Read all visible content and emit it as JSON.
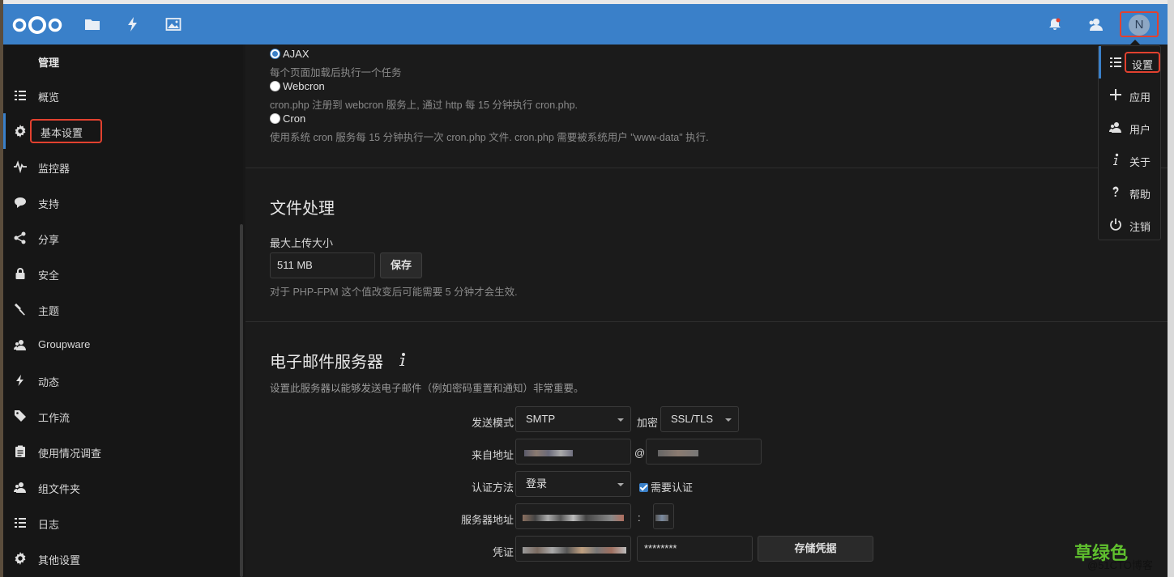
{
  "header": {
    "apps": [
      "files-icon",
      "activity-icon",
      "gallery-icon"
    ],
    "avatar_initial": "N"
  },
  "sidebar": {
    "heading": "管理",
    "items": [
      {
        "label": "概览",
        "icon": "list-icon"
      },
      {
        "label": "基本设置",
        "icon": "gear-icon",
        "active": true
      },
      {
        "label": "监控器",
        "icon": "pulse-icon"
      },
      {
        "label": "支持",
        "icon": "chat-bubble-icon"
      },
      {
        "label": "分享",
        "icon": "share-icon"
      },
      {
        "label": "安全",
        "icon": "lock-icon"
      },
      {
        "label": "主题",
        "icon": "brush-icon"
      },
      {
        "label": "Groupware",
        "icon": "users-icon"
      },
      {
        "label": "动态",
        "icon": "lightning-icon"
      },
      {
        "label": "工作流",
        "icon": "tag-icon"
      },
      {
        "label": "使用情况调查",
        "icon": "clipboard-icon"
      },
      {
        "label": "组文件夹",
        "icon": "group-icon"
      },
      {
        "label": "日志",
        "icon": "log-icon"
      },
      {
        "label": "其他设置",
        "icon": "gear-icon"
      }
    ]
  },
  "cron": {
    "ajax_label": "AJAX",
    "ajax_hint": "每个页面加载后执行一个任务",
    "webcron_label": "Webcron",
    "webcron_hint": "cron.php 注册到 webcron 服务上, 通过 http 每 15 分钟执行 cron.php.",
    "cron_label": "Cron",
    "cron_hint": "使用系统 cron 服务每 15 分钟执行一次 cron.php 文件. cron.php 需要被系统用户 \"www-data\" 执行.",
    "selected": "AJAX"
  },
  "file_handling": {
    "title": "文件处理",
    "max_upload_label": "最大上传大小",
    "max_upload_value": "511 MB",
    "save_label": "保存",
    "hint": "对于 PHP-FPM 这个值改变后可能需要 5 分钟才会生效."
  },
  "email": {
    "title": "电子邮件服务器",
    "info_icon": "info-icon",
    "description": "设置此服务器以能够发送电子邮件（例如密码重置和通知）非常重要。",
    "send_mode_label": "发送模式",
    "send_mode_value": "SMTP",
    "encryption_label": "加密",
    "encryption_value": "SSL/TLS",
    "from_label": "来自地址",
    "at_sign": "@",
    "auth_method_label": "认证方法",
    "auth_method_value": "登录",
    "auth_required_label": "需要认证",
    "server_label": "服务器地址",
    "port_sep": ":",
    "credentials_label": "凭证",
    "password_value": "********",
    "store_label": "存储凭据"
  },
  "user_menu": {
    "items": [
      {
        "label": "设置",
        "icon": "list-icon",
        "active": true
      },
      {
        "label": "应用",
        "icon": "plus-icon"
      },
      {
        "label": "用户",
        "icon": "users-icon"
      },
      {
        "label": "关于",
        "icon": "info-icon"
      },
      {
        "label": "帮助",
        "icon": "help-icon"
      },
      {
        "label": "注销",
        "icon": "power-icon"
      }
    ]
  },
  "watermark": {
    "line1": "草绿色",
    "line2": "@51CTO博客"
  },
  "colors": {
    "header": "#3a80c9",
    "highlight": "#e2412f",
    "background": "#181818"
  }
}
